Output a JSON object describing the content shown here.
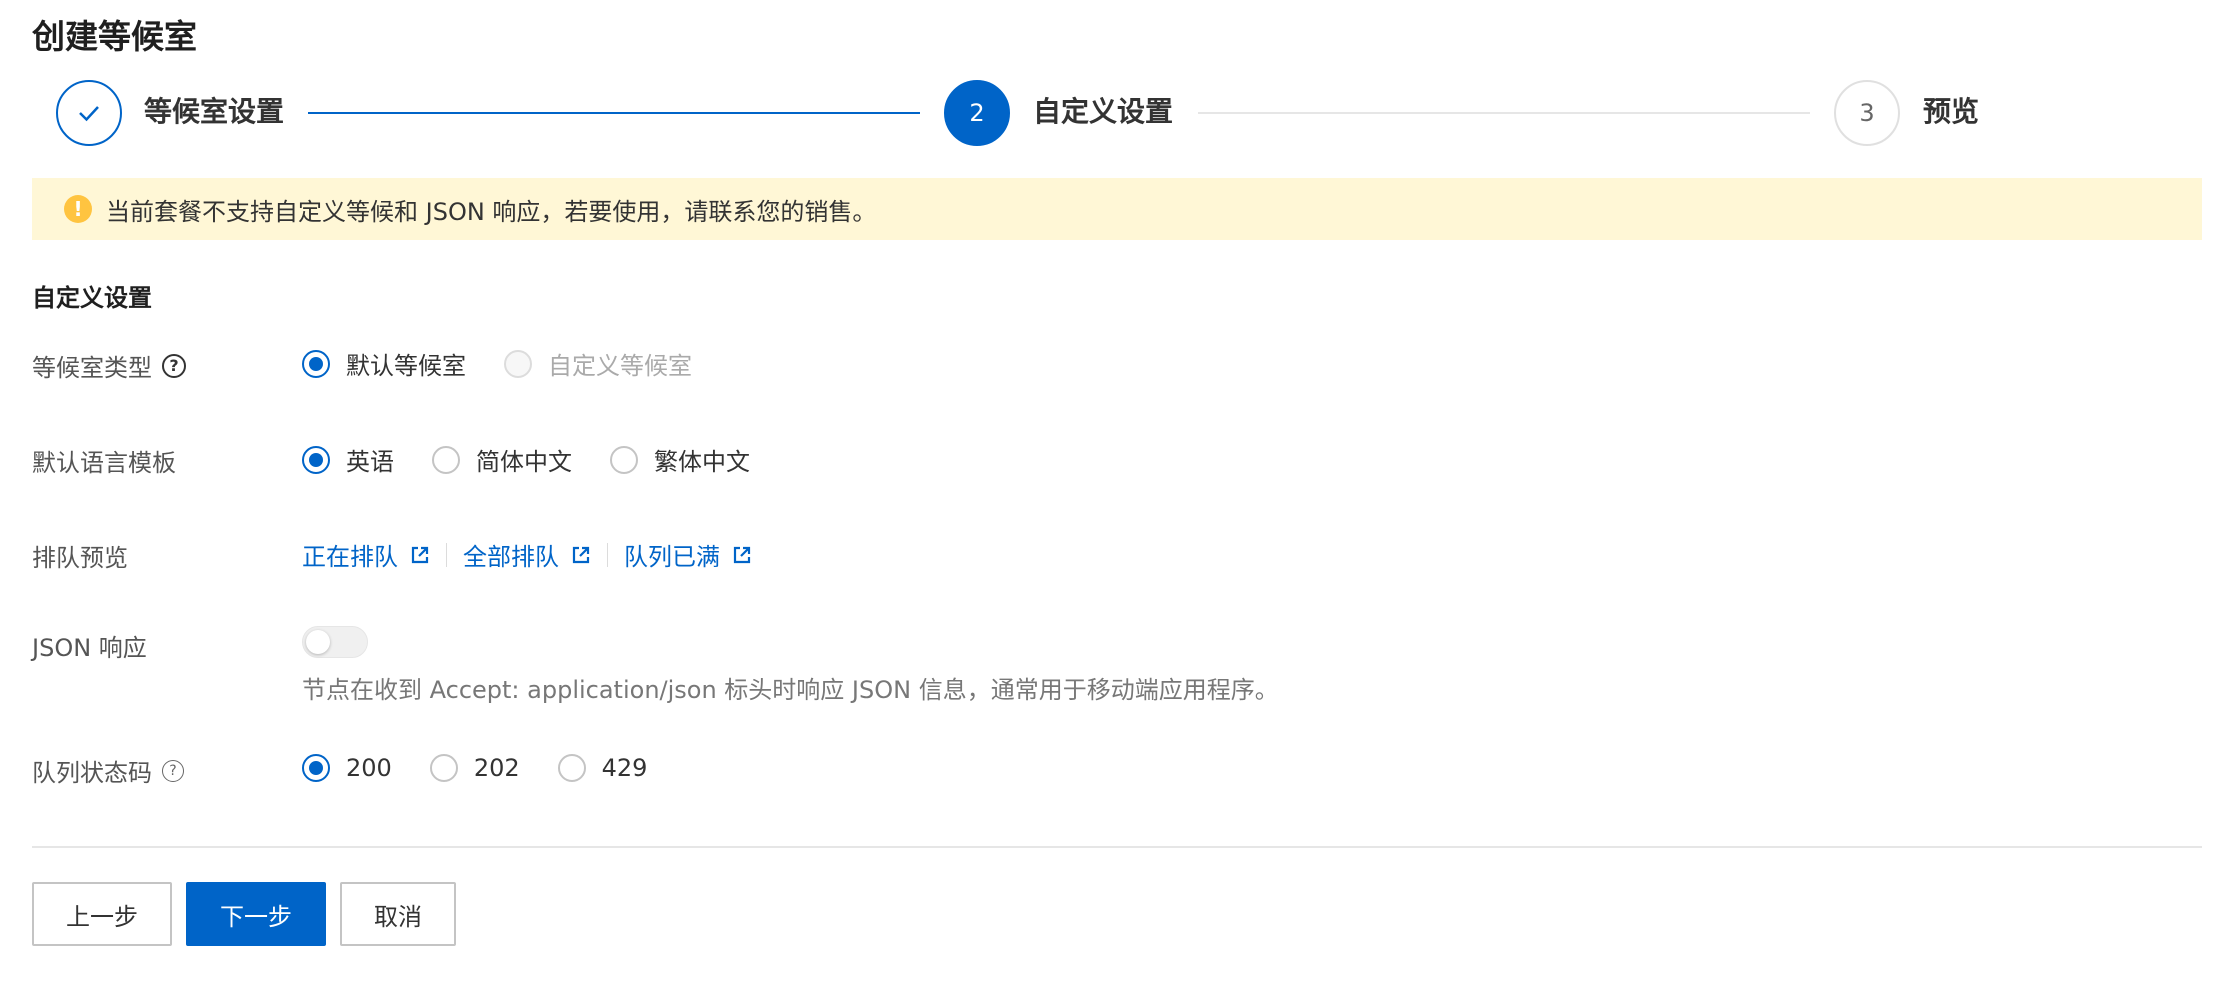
{
  "page": {
    "title": "创建等候室"
  },
  "steps": [
    {
      "label": "等候室设置",
      "status": "done",
      "number": ""
    },
    {
      "label": "自定义设置",
      "status": "active",
      "number": "2"
    },
    {
      "label": "预览",
      "status": "todo",
      "number": "3"
    }
  ],
  "alert": {
    "text": "当前套餐不支持自定义等候和 JSON 响应，若要使用，请联系您的销售。",
    "icon": "warning-icon"
  },
  "section": {
    "title": "自定义设置"
  },
  "waiting_room_type": {
    "label": "等候室类型",
    "options": [
      {
        "label": "默认等候室",
        "checked": true,
        "disabled": false
      },
      {
        "label": "自定义等候室",
        "checked": false,
        "disabled": true
      }
    ]
  },
  "language_template": {
    "label": "默认语言模板",
    "options": [
      {
        "label": "英语",
        "checked": true
      },
      {
        "label": "简体中文",
        "checked": false
      },
      {
        "label": "繁体中文",
        "checked": false
      }
    ]
  },
  "queue_preview": {
    "label": "排队预览",
    "links": [
      "正在排队",
      "全部排队",
      "队列已满"
    ]
  },
  "json_response": {
    "label": "JSON 响应",
    "enabled": false,
    "hint": "节点在收到 Accept: application/json 标头时响应 JSON 信息，通常用于移动端应用程序。"
  },
  "queue_status_code": {
    "label": "队列状态码",
    "options": [
      {
        "label": "200",
        "checked": true
      },
      {
        "label": "202",
        "checked": false
      },
      {
        "label": "429",
        "checked": false
      }
    ]
  },
  "footer": {
    "prev_label": "上一步",
    "next_label": "下一步",
    "cancel_label": "取消"
  },
  "colors": {
    "primary": "#0064c8",
    "alert_bg": "#fff7d6",
    "warning": "#ffc440"
  }
}
